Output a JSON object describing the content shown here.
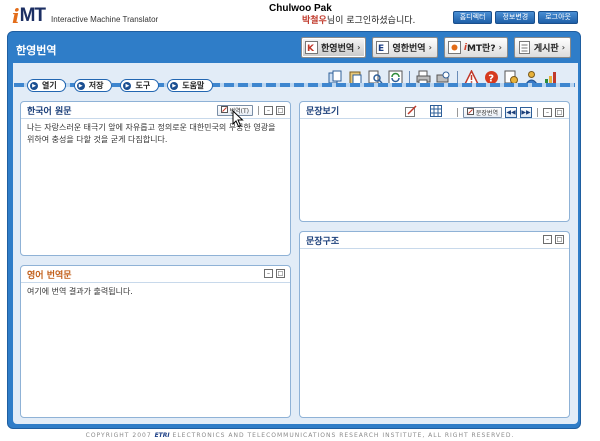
{
  "header": {
    "logo_i": "i",
    "logo_mt": "MT",
    "logo_subtitle": "Interactive Machine Translator",
    "user_name": "Chulwoo Pak",
    "login_message_name": "박철우",
    "login_message_suffix": "님이 로그인하셨습니다.",
    "top_buttons": [
      "홈디렉터",
      "정보변경",
      "로그아웃"
    ]
  },
  "title_bar": {
    "title": "한영번역",
    "tabs": [
      {
        "label": "한영번역",
        "icon": "korean-english-icon"
      },
      {
        "label": "영한번역",
        "icon": "english-korean-icon"
      },
      {
        "label_prefix": "i",
        "label": "MT란?",
        "icon": "info-icon"
      },
      {
        "label": "게시판",
        "icon": "board-icon"
      }
    ]
  },
  "menu": {
    "buttons": [
      "열기",
      "저장",
      "도구",
      "도움말"
    ]
  },
  "toolbar_icons": [
    "copy-icon",
    "paste-icon",
    "find-icon",
    "refresh-icon",
    "print-icon",
    "print-preview-icon",
    "warning-icon",
    "help-icon",
    "settings-icon",
    "user-icon",
    "chart-icon"
  ],
  "panels": {
    "source": {
      "title": "한국어 원문",
      "translate_button": "번역(T)",
      "text": "나는 자랑스러운 태극기 앞에 자유롭고 정의로운 대한민국의 무궁한 영광을 위하여 충성을 다할 것을 굳게 다짐합니다."
    },
    "target": {
      "title": "영어 번역문",
      "text": "여기에 번역 결과가 출력됩니다."
    },
    "sentence_view": {
      "title": "문장보기",
      "button": "문장번역"
    },
    "sentence_structure": {
      "title": "문장구조"
    }
  },
  "footer": {
    "prefix": "COPYRIGHT 2007",
    "brand": "ETRI",
    "suffix": "ELECTRONICS AND TELECOMMUNICATIONS RESEARCH INSTITUTE, ALL RIGHT RESERVED."
  }
}
